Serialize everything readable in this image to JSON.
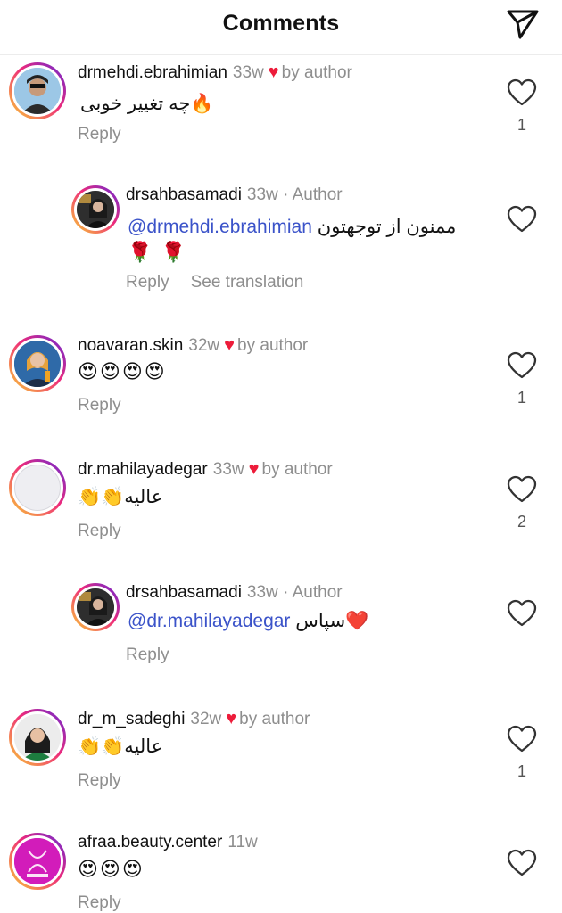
{
  "header": {
    "title": "Comments",
    "send_icon": "paper-plane-icon"
  },
  "comments": [
    {
      "username": "drmehdi.ebrahimian",
      "time": "33w",
      "liked_by": "by author",
      "text": "چه تغییر خوبی🔥",
      "reply": "Reply",
      "likes": "1"
    },
    {
      "username": "drsahbasamadi",
      "time": "33w",
      "tag": "· Author",
      "mention": "@drmehdi.ebrahimian",
      "text": "ممنون از توجهتون",
      "emoji": "🌹 🌹",
      "reply": "Reply",
      "see_translation": "See translation"
    },
    {
      "username": "noavaran.skin",
      "time": "32w",
      "liked_by": "by author",
      "emoji": "😍😍😍😍",
      "reply": "Reply",
      "likes": "1"
    },
    {
      "username": "dr.mahilayadegar",
      "time": "33w",
      "liked_by": "by author",
      "text": "👏👏عالیه",
      "reply": "Reply",
      "likes": "2"
    },
    {
      "username": "drsahbasamadi",
      "time": "33w",
      "tag": "· Author",
      "mention": "@dr.mahilayadegar",
      "text": "سپاس❤️",
      "reply": "Reply"
    },
    {
      "username": "dr_m_sadeghi",
      "time": "32w",
      "liked_by": "by author",
      "text": "👏👏عالیه",
      "reply": "Reply",
      "likes": "1"
    },
    {
      "username": "afraa.beauty.center",
      "time": "11w",
      "emoji": "😍😍😍",
      "reply": "Reply"
    }
  ],
  "colors": {
    "mention": "#3b53c9",
    "heart": "#ed1c3a",
    "muted": "#8e8e8e"
  }
}
